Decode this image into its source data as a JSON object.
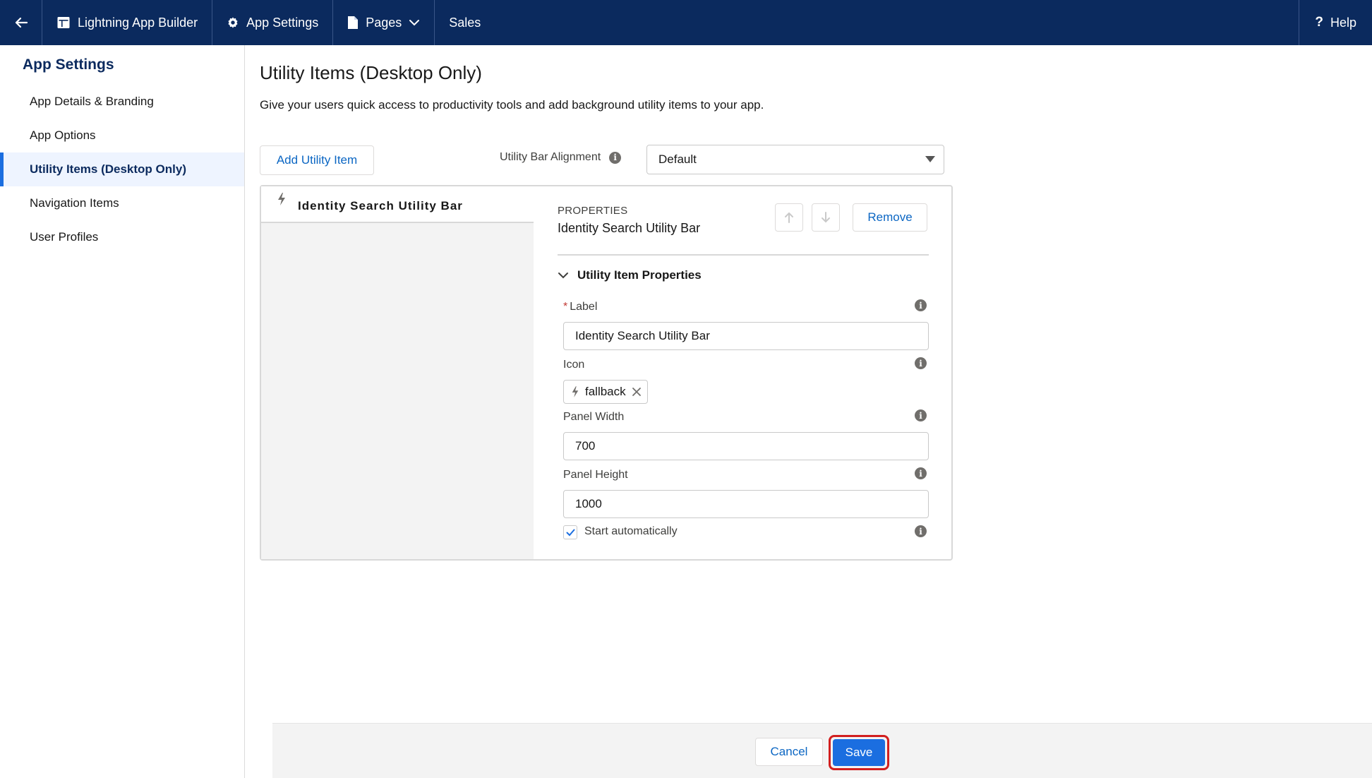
{
  "topbar": {
    "back_icon": "arrow-left-icon",
    "builder_label": "Lightning App Builder",
    "builder_icon": "layout-icon",
    "settings_label": "App Settings",
    "settings_icon": "gear-icon",
    "pages_label": "Pages",
    "pages_icon": "page-icon",
    "app_name": "Sales",
    "help_label": "Help",
    "help_icon": "question-icon",
    "background_color": "#0b2a5e"
  },
  "sidebar": {
    "title": "App Settings",
    "items": [
      {
        "label": "App Details & Branding",
        "active": false
      },
      {
        "label": "App Options",
        "active": false
      },
      {
        "label": "Utility Items (Desktop Only)",
        "active": true
      },
      {
        "label": "Navigation Items",
        "active": false
      },
      {
        "label": "User Profiles",
        "active": false
      }
    ]
  },
  "main": {
    "title": "Utility Items (Desktop Only)",
    "description": "Give your users quick access to productivity tools and add background utility items to your app.",
    "add_button": "Add Utility Item",
    "alignment_label": "Utility Bar Alignment",
    "alignment_value": "Default",
    "utility_list": [
      {
        "name": "Identity Search Utility Bar",
        "icon": "bolt-icon"
      }
    ],
    "properties": {
      "caption": "PROPERTIES",
      "item_name": "Identity Search Utility Bar",
      "remove_button": "Remove",
      "section_title": "Utility Item Properties",
      "label_field": {
        "label": "Label",
        "required_mark": "*",
        "value": "Identity Search Utility Bar"
      },
      "icon_field": {
        "label": "Icon",
        "value": "fallback"
      },
      "panel_width": {
        "label": "Panel Width",
        "value": "700"
      },
      "panel_height": {
        "label": "Panel Height",
        "value": "1000"
      },
      "start_auto": {
        "label": "Start automatically",
        "checked": true
      }
    }
  },
  "footer": {
    "cancel_label": "Cancel",
    "save_label": "Save",
    "accent_color": "#1b6ee0",
    "highlight_color": "#d21f1f"
  }
}
